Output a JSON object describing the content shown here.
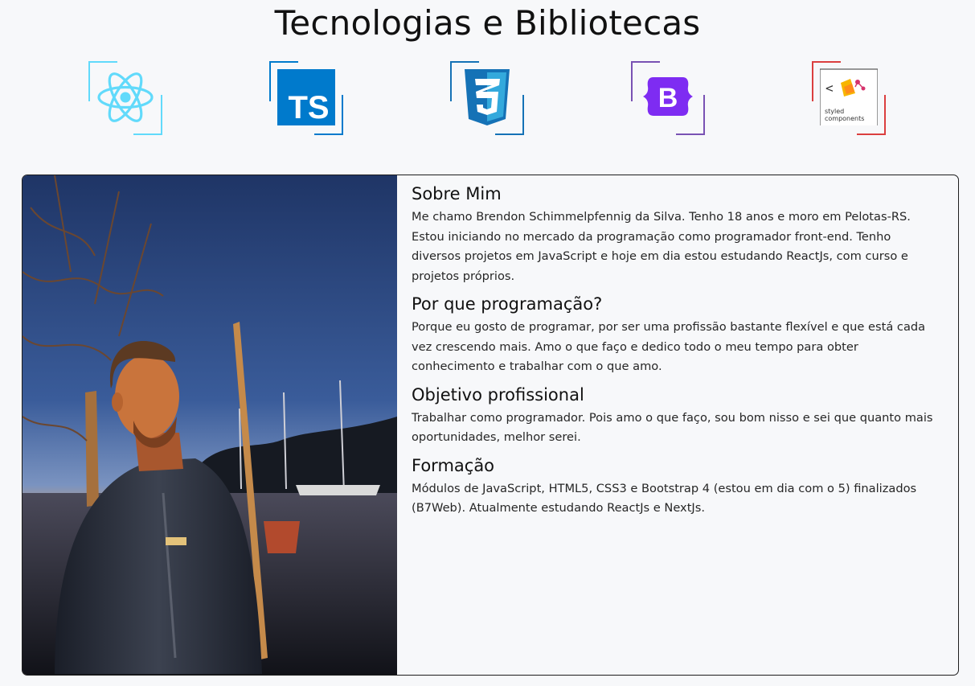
{
  "header": {
    "title": "Tecnologias e Bibliotecas"
  },
  "technologies": [
    {
      "name": "React",
      "icon": "react-icon",
      "color": "#61dafb"
    },
    {
      "name": "TypeScript",
      "icon": "typescript-icon",
      "color": "#007acc",
      "logo_text": "TS"
    },
    {
      "name": "CSS3",
      "icon": "css3-icon",
      "color": "#1572b6",
      "logo_text": "3"
    },
    {
      "name": "Bootstrap",
      "icon": "bootstrap-icon",
      "color": "#7952b3",
      "logo_text": "B"
    },
    {
      "name": "styled-components",
      "icon": "styled-components-icon",
      "color": "#db3f3f",
      "logo_text_line1": "styled",
      "logo_text_line2": "components",
      "logo_brackets": "<"
    }
  ],
  "about": {
    "sections": [
      {
        "title": "Sobre Mim",
        "text": "Me chamo Brendon Schimmelpfennig da Silva. Tenho 18 anos e moro em Pelotas-RS. Estou iniciando no mercado da programação como programador front-end. Tenho diversos projetos em JavaScript e hoje em dia estou estudando ReactJs, com curso e projetos próprios."
      },
      {
        "title": "Por que programação?",
        "text": "Porque eu gosto de programar, por ser uma profissão bastante flexível e que está cada vez crescendo mais. Amo o que faço e dedico todo o meu tempo para obter conhecimento e trabalhar com o que amo."
      },
      {
        "title": "Objetivo profissional",
        "text": "Trabalhar como programador. Pois amo o que faço, sou bom nisso e sei que quanto mais oportunidades, melhor serei."
      },
      {
        "title": "Formação",
        "text": "Módulos de JavaScript, HTML5, CSS3 e Bootstrap 4 (estou em dia com o 5) finalizados (B7Web). Atualmente estudando ReactJs e NextJs."
      }
    ]
  },
  "colors": {
    "background": "#f7f8fa",
    "card_border": "#1d1d1d"
  }
}
